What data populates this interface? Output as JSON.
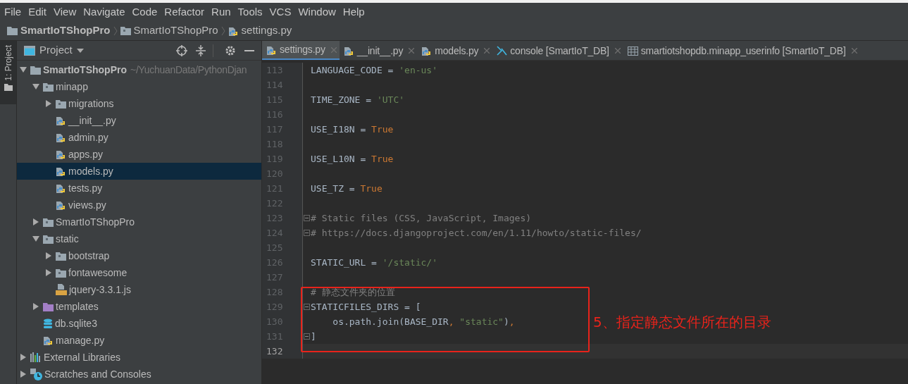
{
  "menu_bar": [
    "File",
    "Edit",
    "View",
    "Navigate",
    "Code",
    "Refactor",
    "Run",
    "Tools",
    "VCS",
    "Window",
    "Help"
  ],
  "breadcrumbs": [
    {
      "label": "SmartIoTShopPro",
      "kind": "project"
    },
    {
      "label": "SmartIoTShopPro",
      "kind": "folder"
    },
    {
      "label": "settings.py",
      "kind": "python"
    }
  ],
  "tool_strip": {
    "label": "1: Project"
  },
  "project_panel": {
    "title": "Project",
    "tree": [
      {
        "name": "SmartIoTShopPro",
        "path": "~/YuchuanData/PythonDjan",
        "kind": "project",
        "expanded": true,
        "selected": false,
        "children": [
          {
            "name": "minapp",
            "kind": "folder",
            "expanded": true,
            "selected": false,
            "children": [
              {
                "name": "migrations",
                "kind": "folder",
                "expanded": false,
                "selected": false
              },
              {
                "name": "__init__.py",
                "kind": "python",
                "selected": false
              },
              {
                "name": "admin.py",
                "kind": "python",
                "selected": false
              },
              {
                "name": "apps.py",
                "kind": "python",
                "selected": false
              },
              {
                "name": "models.py",
                "kind": "python",
                "selected": true
              },
              {
                "name": "tests.py",
                "kind": "python",
                "selected": false
              },
              {
                "name": "views.py",
                "kind": "python",
                "selected": false
              }
            ]
          },
          {
            "name": "SmartIoTShopPro",
            "kind": "folder",
            "expanded": false,
            "selected": false
          },
          {
            "name": "static",
            "kind": "folder",
            "expanded": true,
            "selected": false,
            "children": [
              {
                "name": "bootstrap",
                "kind": "folder",
                "expanded": false,
                "selected": false
              },
              {
                "name": "fontawesome",
                "kind": "folder",
                "expanded": false,
                "selected": false
              },
              {
                "name": "jquery-3.3.1.js",
                "kind": "js",
                "selected": false
              }
            ]
          },
          {
            "name": "templates",
            "kind": "templates",
            "expanded": false,
            "selected": false
          },
          {
            "name": "db.sqlite3",
            "kind": "db",
            "selected": false
          },
          {
            "name": "manage.py",
            "kind": "python",
            "selected": false
          }
        ]
      },
      {
        "name": "External Libraries",
        "kind": "library",
        "expanded": false,
        "selected": false
      },
      {
        "name": "Scratches and Consoles",
        "kind": "scratches",
        "expanded": false,
        "selected": false
      }
    ]
  },
  "tabs": [
    {
      "label": "settings.py",
      "kind": "python",
      "selected": true
    },
    {
      "label": "__init__.py",
      "kind": "python",
      "selected": false
    },
    {
      "label": "models.py",
      "kind": "python",
      "selected": false
    },
    {
      "label": "console [SmartIoT_DB]",
      "kind": "console",
      "selected": false
    },
    {
      "label": "smartiotshopdb.minapp_userinfo [SmartIoT_DB]",
      "kind": "table",
      "selected": false
    }
  ],
  "editor": {
    "lines": [
      {
        "number": "113",
        "segments": [
          {
            "text": "LANGUAGE_CODE = ",
            "kind": "plain"
          },
          {
            "text": "'en-us'",
            "kind": "string"
          }
        ]
      },
      {
        "number": "114"
      },
      {
        "number": "115",
        "segments": [
          {
            "text": "TIME_ZONE = ",
            "kind": "plain"
          },
          {
            "text": "'UTC'",
            "kind": "string"
          }
        ]
      },
      {
        "number": "116"
      },
      {
        "number": "117",
        "segments": [
          {
            "text": "USE_I18N = ",
            "kind": "plain"
          },
          {
            "text": "True",
            "kind": "keyword"
          }
        ]
      },
      {
        "number": "118"
      },
      {
        "number": "119",
        "segments": [
          {
            "text": "USE_L10N = ",
            "kind": "plain"
          },
          {
            "text": "True",
            "kind": "keyword"
          }
        ]
      },
      {
        "number": "120"
      },
      {
        "number": "121",
        "segments": [
          {
            "text": "USE_TZ = ",
            "kind": "plain"
          },
          {
            "text": "True",
            "kind": "keyword"
          }
        ]
      },
      {
        "number": "122"
      },
      {
        "number": "123",
        "fold": true,
        "segments": [
          {
            "text": "# Static files (CSS, JavaScript, Images)",
            "kind": "comment"
          }
        ]
      },
      {
        "number": "124",
        "fold": true,
        "segments": [
          {
            "text": "# https://docs.djangoproject.com/en/1.11/howto/static-files/",
            "kind": "comment"
          }
        ]
      },
      {
        "number": "125"
      },
      {
        "number": "126",
        "segments": [
          {
            "text": "STATIC_URL = ",
            "kind": "plain"
          },
          {
            "text": "'/static/'",
            "kind": "string"
          }
        ]
      },
      {
        "number": "127"
      },
      {
        "number": "128",
        "segments": [
          {
            "text": "# 静态文件夹的位置",
            "kind": "comment"
          }
        ]
      },
      {
        "number": "129",
        "fold": true,
        "segments": [
          {
            "text": "STATICFILES_DIRS = [",
            "kind": "plain"
          }
        ]
      },
      {
        "number": "130",
        "segments": [
          {
            "text": "    os.path.join(BASE_DIR",
            "kind": "plain"
          },
          {
            "text": ", ",
            "kind": "keyword"
          },
          {
            "text": "\"static\"",
            "kind": "string"
          },
          {
            "text": ")",
            "kind": "plain"
          },
          {
            "text": ",",
            "kind": "keyword"
          }
        ]
      },
      {
        "number": "131",
        "fold": true,
        "segments": [
          {
            "text": "]",
            "kind": "plain"
          }
        ]
      },
      {
        "number": "132",
        "current": true
      }
    ],
    "annotation": {
      "text": "5、指定静态文件所在的目录"
    }
  }
}
